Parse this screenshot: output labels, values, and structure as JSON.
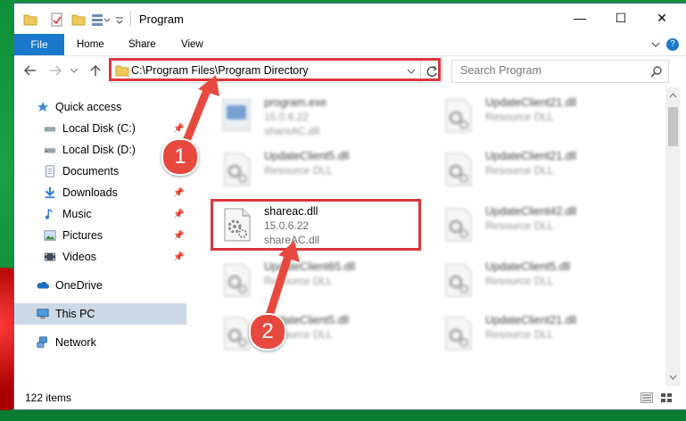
{
  "window": {
    "title": "Program",
    "minimize": "—",
    "maximize": "☐",
    "close": "✕"
  },
  "ribbon": {
    "tabs": [
      "File",
      "Home",
      "Share",
      "View"
    ],
    "help": "?"
  },
  "address": {
    "path": "C:\\Program Files\\Program Directory",
    "search_placeholder": "Search Program"
  },
  "nav": {
    "items": [
      {
        "label": "Quick access",
        "icon": "star-icon",
        "pinned": false
      },
      {
        "label": "Local Disk (C:)",
        "icon": "drive-icon",
        "pinned": true
      },
      {
        "label": "Local Disk (D:)",
        "icon": "drive-icon",
        "pinned": false
      },
      {
        "label": "Documents",
        "icon": "document-icon",
        "pinned": true
      },
      {
        "label": "Downloads",
        "icon": "download-icon",
        "pinned": true
      },
      {
        "label": "Music",
        "icon": "music-icon",
        "pinned": true
      },
      {
        "label": "Pictures",
        "icon": "picture-icon",
        "pinned": true
      },
      {
        "label": "Videos",
        "icon": "video-icon",
        "pinned": true
      },
      {
        "label": "OneDrive",
        "icon": "cloud-icon",
        "pinned": false
      },
      {
        "label": "This PC",
        "icon": "computer-icon",
        "pinned": false,
        "selected": true
      },
      {
        "label": "Network",
        "icon": "network-icon",
        "pinned": false
      }
    ]
  },
  "files": {
    "left_column": [
      {
        "name": "program.exe",
        "line2": "15.0.6.22",
        "line3": "shareAC.dll",
        "blurred": true
      },
      {
        "name": "UpdateClient5.dll",
        "line2": "Resource DLL",
        "line3": "",
        "blurred": true
      },
      {
        "name": "shareac.dll",
        "line2": "15.0.6.22",
        "line3": "shareAC.dll",
        "blurred": false
      },
      {
        "name": "UpdateClient65.dll",
        "line2": "Resource DLL",
        "line3": "",
        "blurred": true
      },
      {
        "name": "UpdateClient5.dll",
        "line2": "Resource DLL",
        "line3": "",
        "blurred": true
      }
    ],
    "right_column": [
      {
        "name": "UpdateClient21.dll",
        "line2": "Resource DLL",
        "line3": "",
        "blurred": true
      },
      {
        "name": "UpdateClient21.dll",
        "line2": "Resource DLL",
        "line3": "",
        "blurred": true
      },
      {
        "name": "UpdateClient42.dll",
        "line2": "Resource DLL",
        "line3": "",
        "blurred": true
      },
      {
        "name": "UpdateClient5.dll",
        "line2": "Resource DLL",
        "line3": "",
        "blurred": true
      },
      {
        "name": "UpdateClient21.dll",
        "line2": "Resource DLL",
        "line3": "",
        "blurred": true
      }
    ]
  },
  "status": {
    "item_count": "122 items"
  },
  "annotations": {
    "step1": "1",
    "step2": "2",
    "highlight_color": "#d9363e",
    "accent": "#1979ca"
  }
}
